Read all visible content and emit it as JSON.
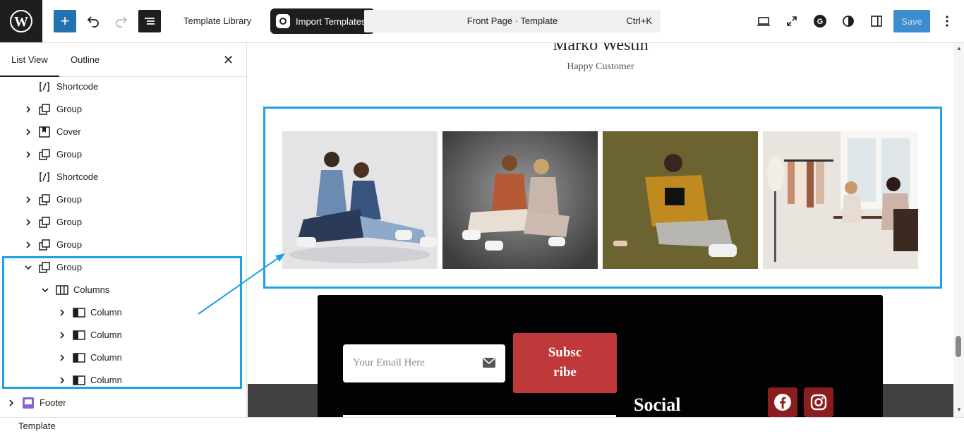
{
  "topbar": {
    "template_library": "Template Library",
    "import_templates": "Import Templates",
    "command": {
      "title": "Front Page · Template",
      "shortcut": "Ctrl+K"
    },
    "save": "Save",
    "icons": [
      "wordpress-logo",
      "plus-icon",
      "undo-icon",
      "redo-icon",
      "list-view-icon",
      "desktop-icon",
      "fullscreen-icon",
      "gutenverse-icon",
      "styles-icon",
      "sidebar-icon",
      "more-vertical-icon"
    ]
  },
  "sidebar": {
    "tabs": [
      "List View",
      "Outline"
    ],
    "rows": [
      {
        "label": "Shortcode",
        "icon": "shortcode"
      },
      {
        "label": "Group",
        "icon": "group"
      },
      {
        "label": "Cover",
        "icon": "cover"
      },
      {
        "label": "Group",
        "icon": "group"
      },
      {
        "label": "Shortcode",
        "icon": "shortcode"
      },
      {
        "label": "Group",
        "icon": "group"
      },
      {
        "label": "Group",
        "icon": "group"
      },
      {
        "label": "Group",
        "icon": "group"
      },
      {
        "label": "Group",
        "icon": "group"
      },
      {
        "label": "Columns",
        "icon": "columns"
      },
      {
        "label": "Column",
        "icon": "column"
      },
      {
        "label": "Column",
        "icon": "column"
      },
      {
        "label": "Column",
        "icon": "column"
      },
      {
        "label": "Column",
        "icon": "column"
      },
      {
        "label": "Footer",
        "icon": "footer"
      }
    ]
  },
  "canvas": {
    "testimonial_name": "Marko Westin",
    "testimonial_role": "Happy Customer",
    "email_placeholder": "Your Email Here",
    "subscribe_line1": "Subsc",
    "subscribe_line2": "ribe",
    "social_title": "Social"
  },
  "statusbar": {
    "label": "Template"
  },
  "colors": {
    "accent": "#1ea1e8",
    "wp_blue": "#2271b1",
    "subscribe": "#c0393a",
    "social": "#8b1d1f"
  }
}
